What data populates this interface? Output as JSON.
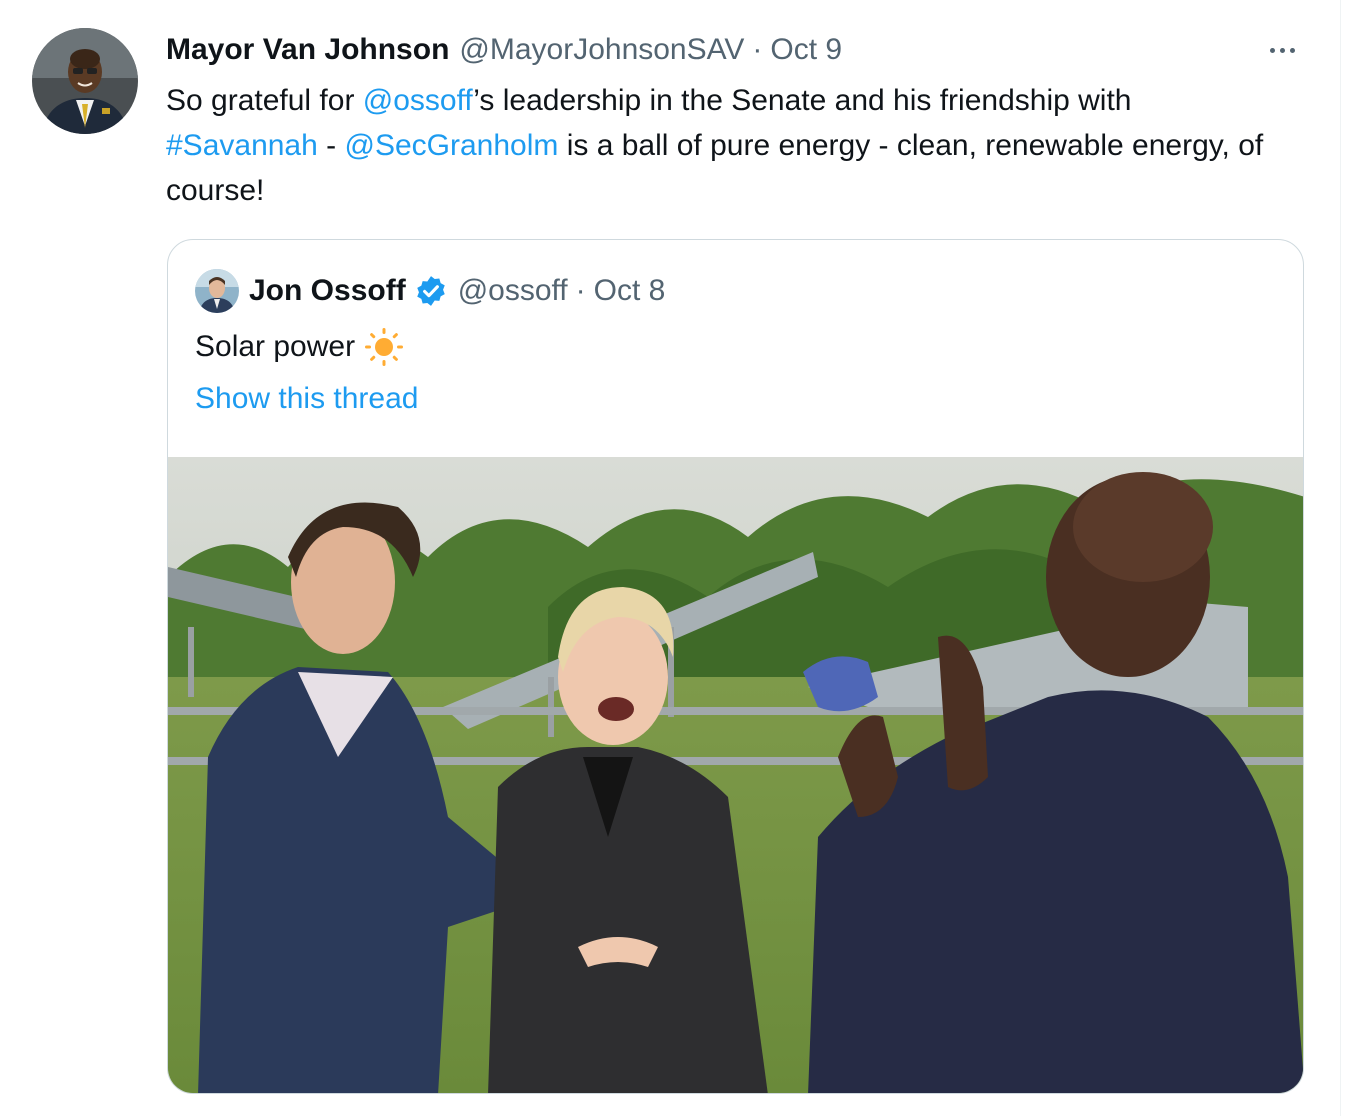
{
  "tweet": {
    "author_name": "Mayor Van Johnson",
    "author_handle": "@MayorJohnsonSAV",
    "separator": "·",
    "timestamp": "Oct 9",
    "avatar_icon": "profile-photo-mayor",
    "more_icon": "ellipsis-icon",
    "text": {
      "p1": "So grateful for ",
      "mention1": "@ossoff",
      "p2": "’s leadership in the Senate and his friendship with ",
      "hashtag": "#Savannah",
      "p3": " - ",
      "mention2": "@SecGranholm",
      "p4": " is a ball of pure energy - clean, renewable energy, of course!"
    }
  },
  "quoted_tweet": {
    "author_name": "Jon Ossoff",
    "verified_icon": "verified-badge-icon",
    "author_handle": "@ossoff",
    "separator": "·",
    "timestamp": "Oct 8",
    "text": "Solar power",
    "emoji_icon": "sun-emoji-icon",
    "show_thread": "Show this thread",
    "media_icon": "photo-solar-field-three-people"
  },
  "colors": {
    "link": "#1d9bf0",
    "text": "#0f1419",
    "secondary": "#536471",
    "border": "#cfd9de"
  }
}
